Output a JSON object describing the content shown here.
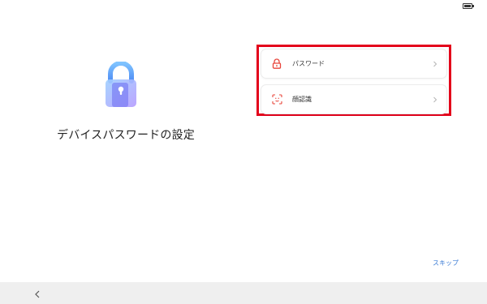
{
  "status_bar": {
    "battery_icon": "battery-icon"
  },
  "main": {
    "illustration_icon": "lock-icon",
    "title": "デバイスパスワードの設定"
  },
  "options": [
    {
      "label": "パスワード",
      "icon": "lock-icon",
      "accent": "#e8443a"
    },
    {
      "label": "顔認識",
      "icon": "face-scan-icon",
      "accent": "#e8443a"
    }
  ],
  "skip_label": "スキップ",
  "nav": {
    "back_icon": "back-chevron-icon"
  },
  "colors": {
    "highlight": "#e3001b",
    "link": "#3a7bd5",
    "nav_bar": "#efefef",
    "lock_gradient": [
      "#8ec5ff",
      "#a58cff"
    ]
  }
}
